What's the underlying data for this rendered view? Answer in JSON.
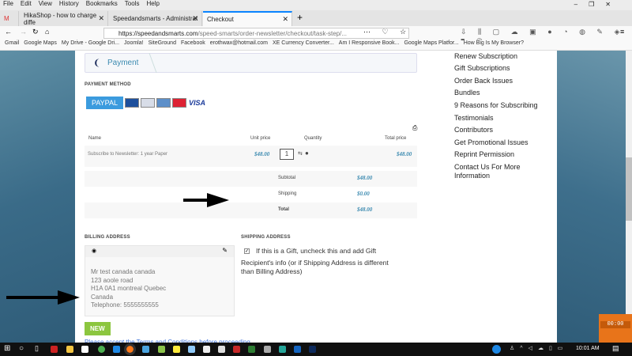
{
  "menubar": [
    "File",
    "Edit",
    "View",
    "History",
    "Bookmarks",
    "Tools",
    "Help"
  ],
  "tabs": [
    {
      "label": "HikaShop - how to charge diffe"
    },
    {
      "label": "Speedandsmarts - Administrat"
    },
    {
      "label": "Checkout",
      "active": true
    }
  ],
  "url": {
    "domain": "https://speedandsmarts.com",
    "path": "/speed-smarts/order-newsletter/checkout/task-step/..."
  },
  "bookmarks": [
    "Gmail",
    "Google Maps",
    "My Drive - Google Dri...",
    "Joomla!",
    "SiteGround",
    "Facebook",
    "erothwax@hotmail.com",
    "XE Currency Converter...",
    "Am I Responsive Book...",
    "Google Maps Platfor...",
    "How Big Is My Browser?"
  ],
  "checkout": {
    "step": "Payment",
    "payment_method_title": "PAYMENT METHOD",
    "paypal_label": "PAYPAL",
    "visa_label": "VISA",
    "cart": {
      "headers": [
        "Name",
        "Unit price",
        "Quantity",
        "Total price"
      ],
      "items": [
        {
          "name": "Subscribe to Newsletter: 1 year Paper",
          "unit_price": "$48.00",
          "quantity": "1",
          "total": "$48.00"
        }
      ],
      "subtotal_label": "Subtotal",
      "subtotal": "$48.00",
      "shipping_label": "Shipping",
      "shipping": "$0.00",
      "total_label": "Total",
      "total": "$48.00"
    },
    "billing_title": "BILLING ADDRESS",
    "billing_address": [
      "Mr test canada canada",
      "123 aoole road",
      "H1A 0A1 montreal Quebec",
      "Canada",
      "Telephone: 5555555555"
    ],
    "new_label": "NEW",
    "shipping_title": "SHIPPING ADDRESS",
    "gift_checkbox_label": "If this is a Gift, uncheck this and add Gift",
    "gift_note": "Recipient's info (or if Shipping Address is different than Billing Address)",
    "gift_checked": true,
    "terms_text": "Please accept the Terms and Conditions before proceeding"
  },
  "sidebar": [
    "Renew Subscription",
    "Gift Subscriptions",
    "Order Back Issues",
    "Bundles",
    "9 Reasons for Subscribing",
    "Testimonials",
    "Contributors",
    "Get Promotional Issues",
    "Reprint Permission",
    "Contact Us For More Information"
  ],
  "taskbar": {
    "time": "10:01 AM"
  },
  "colors": {
    "accent": "#3b8ab0",
    "paypal": "#3b9bde",
    "new_button": "#8cc63f",
    "tab_active": "#0a84ff"
  }
}
